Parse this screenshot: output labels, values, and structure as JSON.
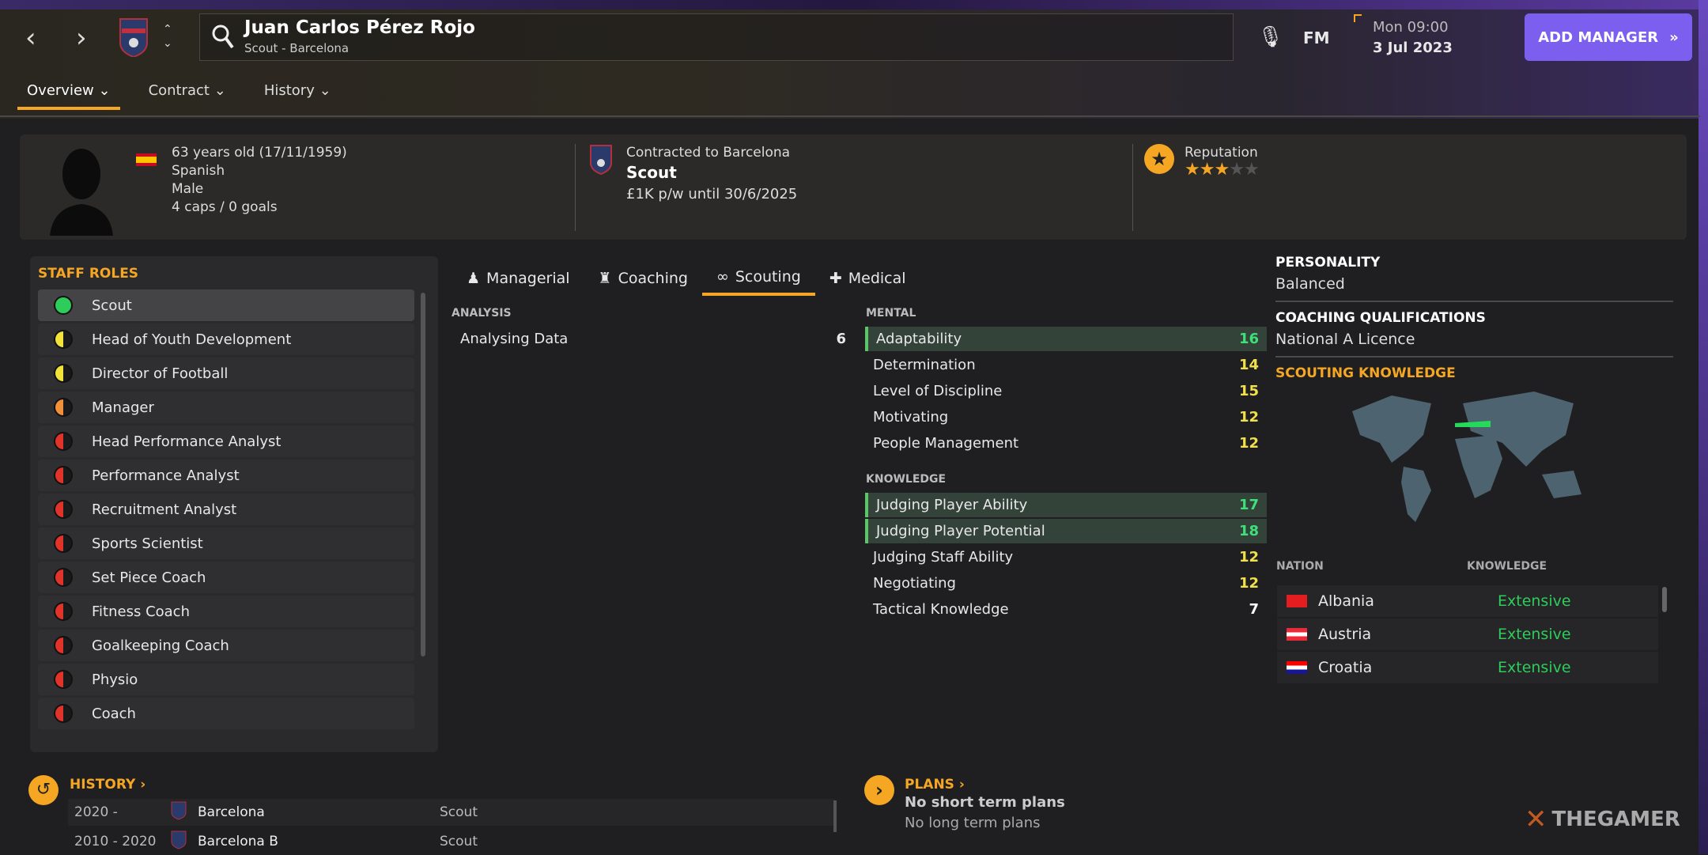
{
  "header": {
    "name": "Juan Carlos Pérez Rojo",
    "subtitle": "Scout - Barcelona",
    "fm_label": "FM",
    "day_time": "Mon 09:00",
    "date": "3 Jul 2023",
    "add_manager": "ADD MANAGER"
  },
  "tabs": [
    {
      "label": "Overview"
    },
    {
      "label": "Contract"
    },
    {
      "label": "History"
    }
  ],
  "profile": {
    "age": "63 years old (17/11/1959)",
    "nationality": "Spanish",
    "gender": "Male",
    "caps": "4 caps / 0 goals",
    "contracted": "Contracted to Barcelona",
    "role": "Scout",
    "wage": "£1K p/w until 30/6/2025",
    "reputation_label": "Reputation",
    "reputation_stars": 3,
    "reputation_max": 5
  },
  "staff_roles": {
    "title": "STAFF ROLES",
    "items": [
      {
        "label": "Scout",
        "status": "green"
      },
      {
        "label": "Head of Youth Development",
        "status": "yellow"
      },
      {
        "label": "Director of Football",
        "status": "yellow"
      },
      {
        "label": "Manager",
        "status": "orange"
      },
      {
        "label": "Head Performance Analyst",
        "status": "red"
      },
      {
        "label": "Performance Analyst",
        "status": "red"
      },
      {
        "label": "Recruitment Analyst",
        "status": "red"
      },
      {
        "label": "Sports Scientist",
        "status": "red"
      },
      {
        "label": "Set Piece Coach",
        "status": "red"
      },
      {
        "label": "Fitness Coach",
        "status": "red"
      },
      {
        "label": "Goalkeeping Coach",
        "status": "red"
      },
      {
        "label": "Physio",
        "status": "red"
      },
      {
        "label": "Coach",
        "status": "red"
      }
    ]
  },
  "attr_tabs": [
    {
      "label": "Managerial",
      "icon": "managerial-icon"
    },
    {
      "label": "Coaching",
      "icon": "coaching-icon"
    },
    {
      "label": "Scouting",
      "icon": "binoculars-icon"
    },
    {
      "label": "Medical",
      "icon": "medical-kit-icon"
    }
  ],
  "analysis": {
    "title": "ANALYSIS",
    "items": [
      {
        "label": "Analysing Data",
        "value": "6"
      }
    ]
  },
  "mental": {
    "title": "MENTAL",
    "items": [
      {
        "label": "Adaptability",
        "value": "16",
        "hl": true
      },
      {
        "label": "Determination",
        "value": "14"
      },
      {
        "label": "Level of Discipline",
        "value": "15"
      },
      {
        "label": "Motivating",
        "value": "12"
      },
      {
        "label": "People Management",
        "value": "12"
      }
    ]
  },
  "knowledge": {
    "title": "KNOWLEDGE",
    "items": [
      {
        "label": "Judging Player Ability",
        "value": "17",
        "hl": true
      },
      {
        "label": "Judging Player Potential",
        "value": "18",
        "hl": true
      },
      {
        "label": "Judging Staff Ability",
        "value": "12"
      },
      {
        "label": "Negotiating",
        "value": "12"
      },
      {
        "label": "Tactical Knowledge",
        "value": "7"
      }
    ]
  },
  "right": {
    "personality_title": "PERSONALITY",
    "personality": "Balanced",
    "quals_title": "COACHING QUALIFICATIONS",
    "quals": "National A Licence",
    "scouting_title": "SCOUTING KNOWLEDGE",
    "col_nation": "NATION",
    "col_knowledge": "KNOWLEDGE",
    "nations": [
      {
        "name": "Albania",
        "knowledge": "Extensive"
      },
      {
        "name": "Austria",
        "knowledge": "Extensive"
      },
      {
        "name": "Croatia",
        "knowledge": "Extensive"
      }
    ]
  },
  "history": {
    "title": "HISTORY",
    "rows": [
      {
        "years": "2020 -",
        "club": "Barcelona",
        "role": "Scout"
      },
      {
        "years": "2010 - 2020",
        "club": "Barcelona B",
        "role": "Scout"
      }
    ]
  },
  "plans": {
    "title": "PLANS",
    "short": "No short term plans",
    "long": "No long term plans"
  },
  "watermark": "THEGAMER",
  "colors": {
    "accent": "#f5a623",
    "button": "#7d5ff0",
    "good": "#3ee07a",
    "mid": "#f0e04a",
    "green": "#2ecc5a",
    "yellow": "#f2e33a",
    "orange": "#f0913a",
    "red": "#e0342a"
  }
}
